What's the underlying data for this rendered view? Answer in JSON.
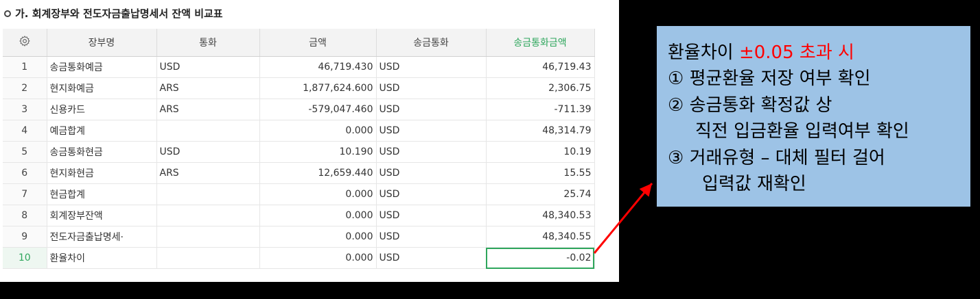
{
  "panel": {
    "title": "가. 회계장부와 전도자금출납명세서 잔액 비교표"
  },
  "table": {
    "settings_icon": "gear-icon",
    "headers": [
      "장부명",
      "통화",
      "금액",
      "송금통화",
      "송금통화금액"
    ],
    "rows": [
      {
        "no": "1",
        "name": "송금통화예금",
        "currency": "USD",
        "amount": "46,719.430",
        "remit_currency": "USD",
        "remit_amount": "46,719.43"
      },
      {
        "no": "2",
        "name": "현지화예금",
        "currency": "ARS",
        "amount": "1,877,624.600",
        "remit_currency": "USD",
        "remit_amount": "2,306.75"
      },
      {
        "no": "3",
        "name": "신용카드",
        "currency": "ARS",
        "amount": "-579,047.460",
        "remit_currency": "USD",
        "remit_amount": "-711.39"
      },
      {
        "no": "4",
        "name": "예금합계",
        "currency": "",
        "amount": "0.000",
        "remit_currency": "USD",
        "remit_amount": "48,314.79"
      },
      {
        "no": "5",
        "name": "송금통화현금",
        "currency": "USD",
        "amount": "10.190",
        "remit_currency": "USD",
        "remit_amount": "10.19"
      },
      {
        "no": "6",
        "name": "현지화현금",
        "currency": "ARS",
        "amount": "12,659.440",
        "remit_currency": "USD",
        "remit_amount": "15.55"
      },
      {
        "no": "7",
        "name": "현금합계",
        "currency": "",
        "amount": "0.000",
        "remit_currency": "USD",
        "remit_amount": "25.74"
      },
      {
        "no": "8",
        "name": "회계장부잔액",
        "currency": "",
        "amount": "0.000",
        "remit_currency": "USD",
        "remit_amount": "48,340.53"
      },
      {
        "no": "9",
        "name": "전도자금출납명세·",
        "currency": "",
        "amount": "0.000",
        "remit_currency": "USD",
        "remit_amount": "48,340.55"
      },
      {
        "no": "10",
        "name": "환율차이",
        "currency": "",
        "amount": "0.000",
        "remit_currency": "USD",
        "remit_amount": "-0.02"
      }
    ]
  },
  "note": {
    "line1_prefix": "환율차이 ",
    "line1_red": "±0.05 초과 시",
    "line2": "① 평균환율 저장 여부 확인",
    "line3": "② 송금통화 확정값 상",
    "line4": "직전 입금환율 입력여부 확인",
    "line5": "③ 거래유형 – 대체 필터 걸어",
    "line6": "입력값 재확인"
  },
  "colors": {
    "accent_green": "#2ea65c",
    "note_background": "#9dc3e6",
    "arrow_red": "#ff0000"
  }
}
